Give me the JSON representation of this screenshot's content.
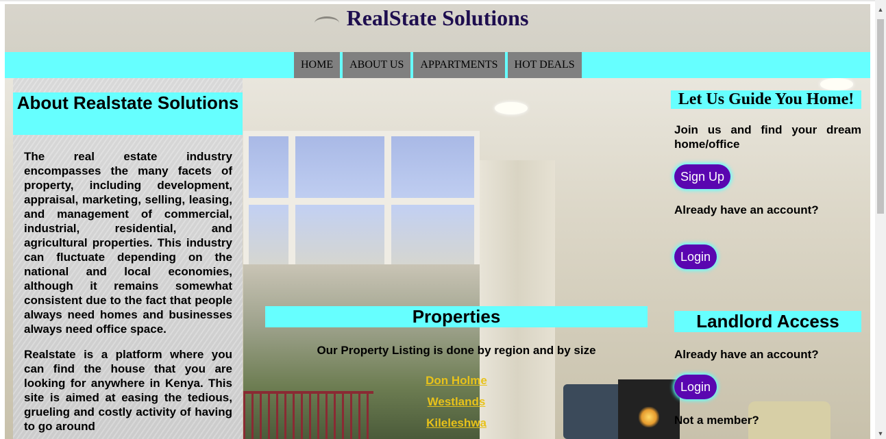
{
  "site": {
    "title": "RealState Solutions"
  },
  "nav": {
    "items": [
      {
        "label": "HOME"
      },
      {
        "label": "ABOUT US"
      },
      {
        "label": "APPARTMENTS"
      },
      {
        "label": "HOT DEALS"
      }
    ]
  },
  "about": {
    "heading": "About Realstate Solutions",
    "paragraphs": [
      "The real estate industry encompasses the many facets of property, including development, appraisal, marketing, selling, leasing, and management of commercial, industrial, residential, and agricultural properties. This industry can fluctuate depending on the national and local economies, although it remains somewhat consistent due to the fact that people always need homes and businesses always need office space.",
      "Realstate is a platform where you can find the house that you are looking for anywhere in Kenya. This site is aimed at easing the tedious, grueling and costly activity of having to go around"
    ]
  },
  "properties": {
    "heading": "Properties",
    "description": "Our Property Listing is done by region and by size",
    "links": [
      "Don Holme",
      "Westlands",
      "Kileleshwa"
    ]
  },
  "guide": {
    "heading": "Let Us Guide You Home!",
    "join_text": "Join us and find your dream home/office",
    "signup_label": "Sign Up",
    "have_account_text": "Already have an account?",
    "login_label": "Login"
  },
  "landlord": {
    "heading": "Landlord Access",
    "have_account_text": "Already have an account?",
    "login_label": "Login",
    "not_member_text": "Not a member?"
  },
  "colors": {
    "accent_cyan": "#66ffff",
    "nav_gray": "#808080",
    "title_purple": "#1e0e4f",
    "button_purple": "#5a06b0",
    "link_gold": "#e8c21a"
  }
}
